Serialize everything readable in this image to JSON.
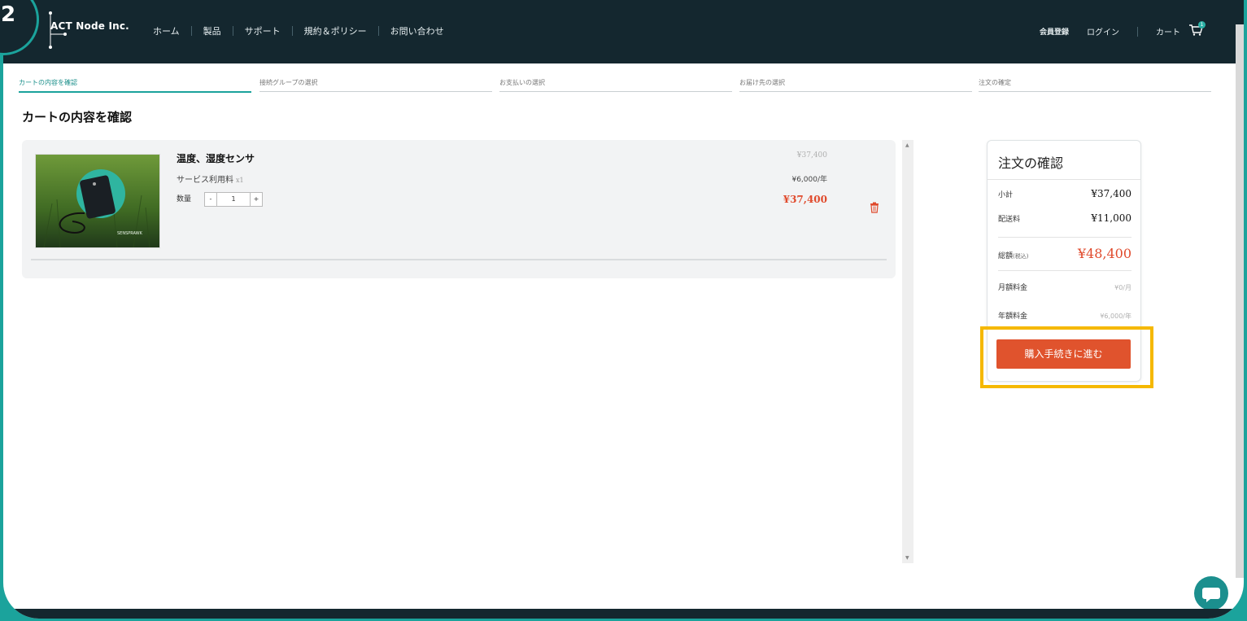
{
  "brand": {
    "name": "ACT Node Inc."
  },
  "corner_badge": {
    "number": "2"
  },
  "nav": {
    "items": [
      "ホーム",
      "製品",
      "サポート",
      "規約＆ポリシー",
      "お問い合わせ"
    ]
  },
  "account": {
    "register": "会員登録",
    "login": "ログイン",
    "cart": "カート",
    "cart_count": "1"
  },
  "steps": [
    "カートの内容を確認",
    "接続グループの選択",
    "お支払いの選択",
    "お届け先の選択",
    "注文の確定"
  ],
  "active_step": "カートの内容を確認",
  "page": {
    "title": "カートの内容を確認"
  },
  "cart": {
    "item": {
      "name": "温度、湿度センサ",
      "list_price": "¥37,400",
      "service_label": "サービス利用料",
      "service_qty": "x1",
      "service_price": "¥6,000/年",
      "qty_label": "数量",
      "qty_minus": "-",
      "qty_value": "1",
      "qty_plus": "+",
      "price": "¥37,400",
      "image_icon": "sensor-product-photo",
      "image_logo": "SENSPRAWK"
    }
  },
  "summary": {
    "title": "注文の確認",
    "subtotal_label": "小計",
    "subtotal": "¥37,400",
    "shipping_label": "配送料",
    "shipping": "¥11,000",
    "total_label": "総額",
    "total_note": "(税込)",
    "total": "¥48,400",
    "monthly_label": "月額料金",
    "monthly": "¥0/月",
    "yearly_label": "年額料金",
    "yearly": "¥6,000/年",
    "button": "購入手続きに進む"
  },
  "colors": {
    "header_bg": "#14272f",
    "accent_teal": "#1ba39c",
    "price_red": "#e04a2c",
    "button": "#e0532d",
    "highlight": "#f5b800"
  }
}
